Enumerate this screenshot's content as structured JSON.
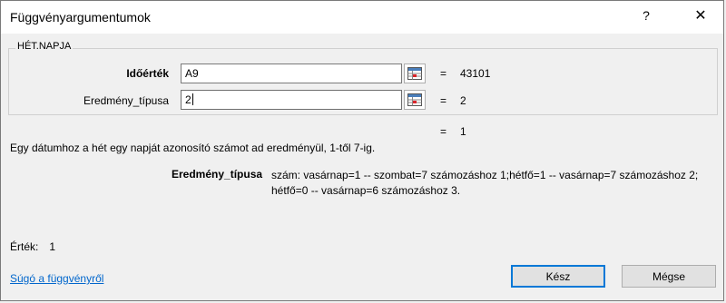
{
  "window": {
    "title": "Függvényargumentumok",
    "help_glyph": "?",
    "close_glyph": "✕"
  },
  "function": {
    "name": "HÉT.NAPJA",
    "args": [
      {
        "label": "Időérték",
        "value": "A9",
        "result": "43101"
      },
      {
        "label": "Eredmény_típusa",
        "value": "2",
        "result": "2"
      }
    ],
    "formula_result": "1",
    "description": "Egy dátumhoz a hét egy napját azonosító számot ad eredményül, 1-től 7-ig.",
    "param_name": "Eredmény_típusa",
    "param_description": "szám: vasárnap=1 -- szombat=7 számozáshoz 1;hétfő=1 -- vasárnap=7 számozáshoz 2; hétfő=0 -- vasárnap=6 számozáshoz 3."
  },
  "value": {
    "label": "Érték:",
    "result": "1"
  },
  "help_link": "Súgó a függvényről",
  "buttons": {
    "ok": "Kész",
    "cancel": "Mégse"
  },
  "equals": "="
}
